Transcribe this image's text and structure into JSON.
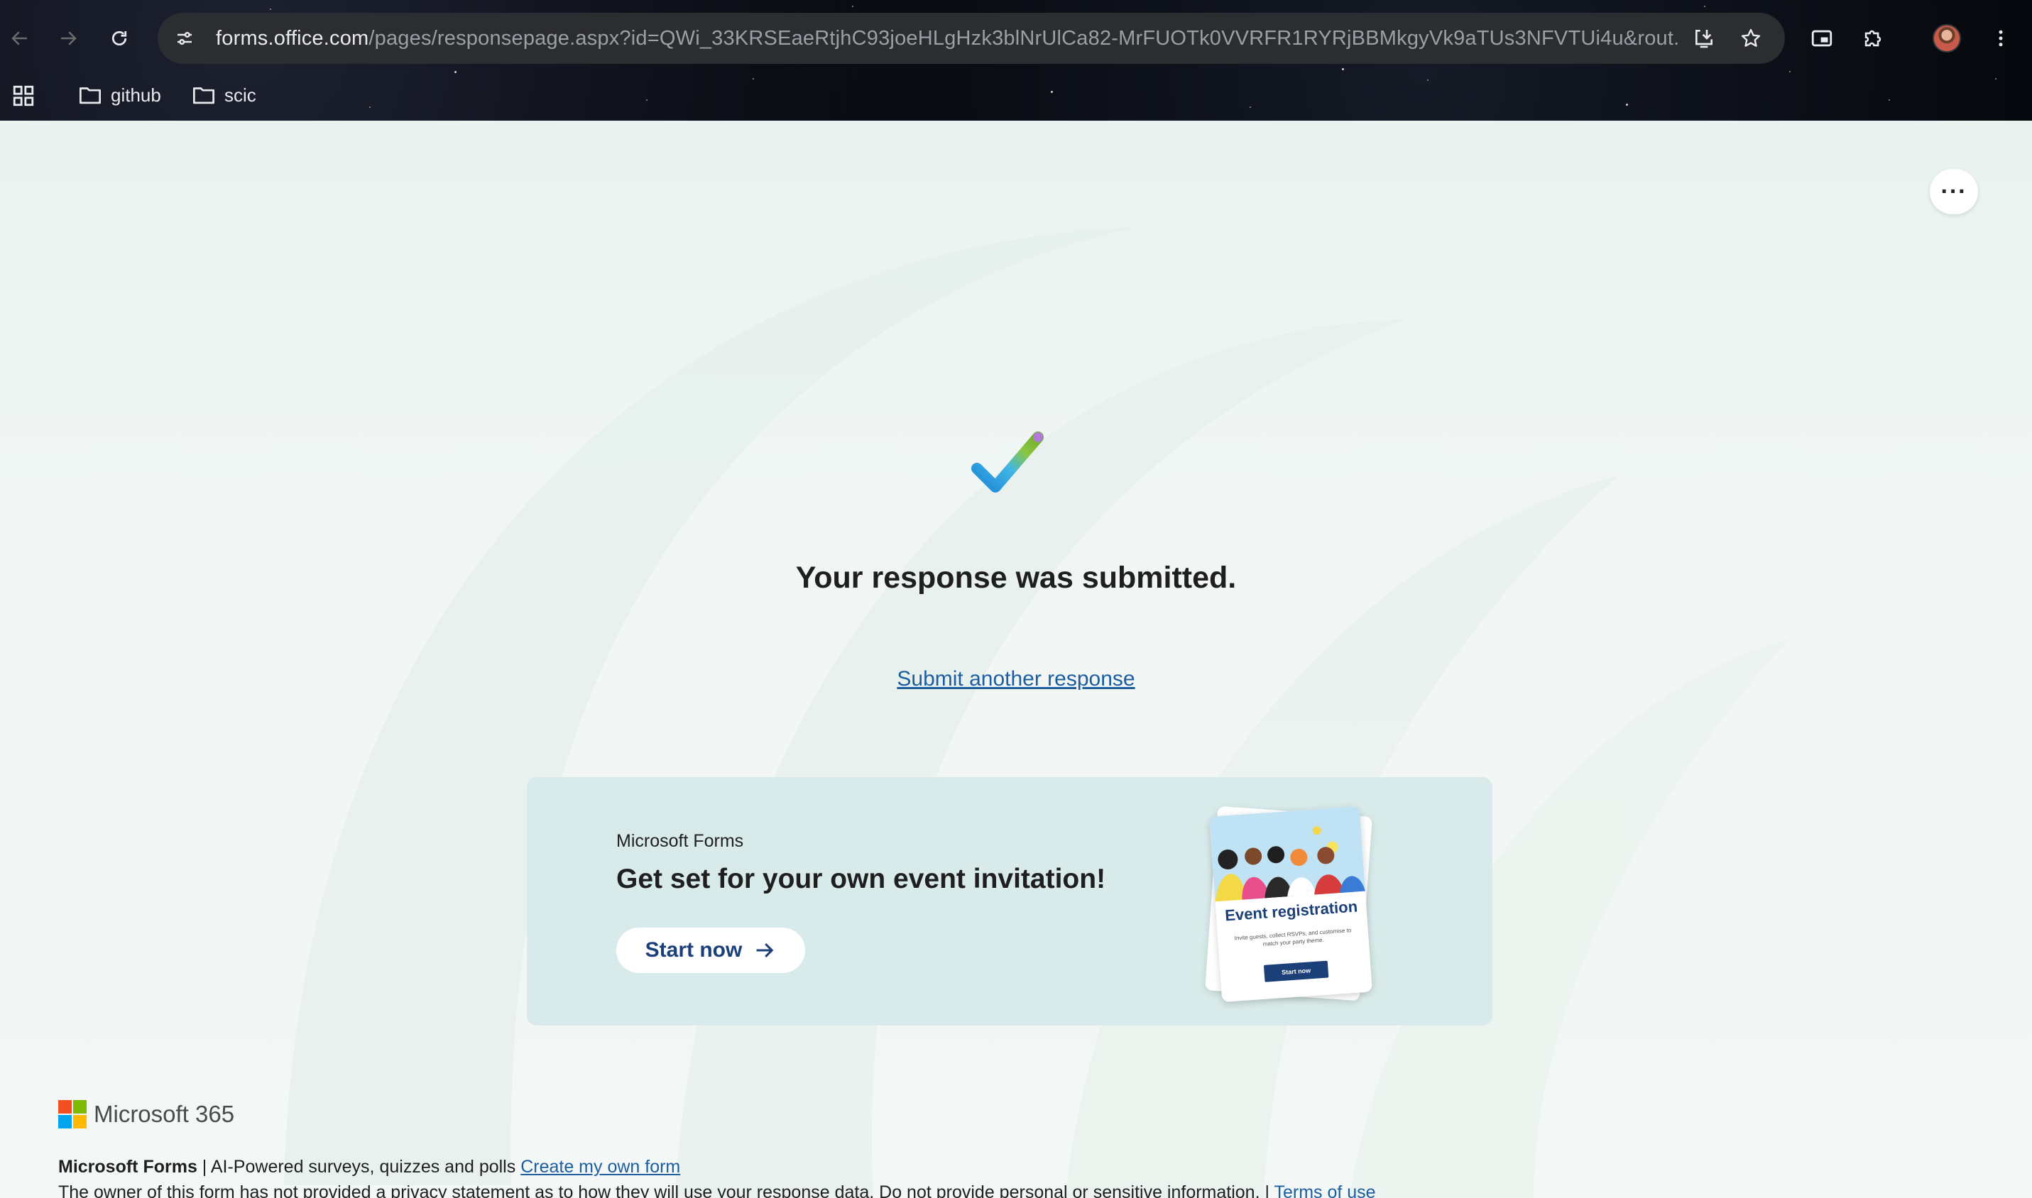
{
  "browser": {
    "url_host": "forms.office.com",
    "url_path": "/pages/responsepage.aspx?id=QWi_33KRSEaeRtjhC93joeHLgHzk3blNrUlCa82-MrFUOTk0VVRFR1RYRjBBMkgyVk9aTUs3NFVTUi4u&rout...",
    "bookmarks": [
      "github",
      "scic"
    ]
  },
  "page": {
    "more_label": "···",
    "title": "Your response was submitted.",
    "submit_another": "Submit another response"
  },
  "promo": {
    "brand": "Microsoft Forms",
    "heading": "Get set for your own event invitation!",
    "button": "Start now",
    "card_title": "Event registration",
    "card_desc": "Invite guests, collect RSVPs, and customise to match your party theme.",
    "card_button": "Start now"
  },
  "footer": {
    "logo_text": "Microsoft 365",
    "product": "Microsoft Forms",
    "tagline": " | AI-Powered surveys, quizzes and polls ",
    "create_link": "Create my own form",
    "privacy": "The owner of this form has not provided a privacy statement as to how they will use your response data. Do not provide personal or sensitive information. | ",
    "terms_link": "Terms of use"
  },
  "colors": {
    "accent_link": "#1c5ea0",
    "promo_bg": "#d8eae9",
    "brand_blue": "#1b3f78",
    "ms_red": "#f25022",
    "ms_green": "#7fba00",
    "ms_blue": "#00a4ef",
    "ms_yellow": "#ffb900"
  }
}
